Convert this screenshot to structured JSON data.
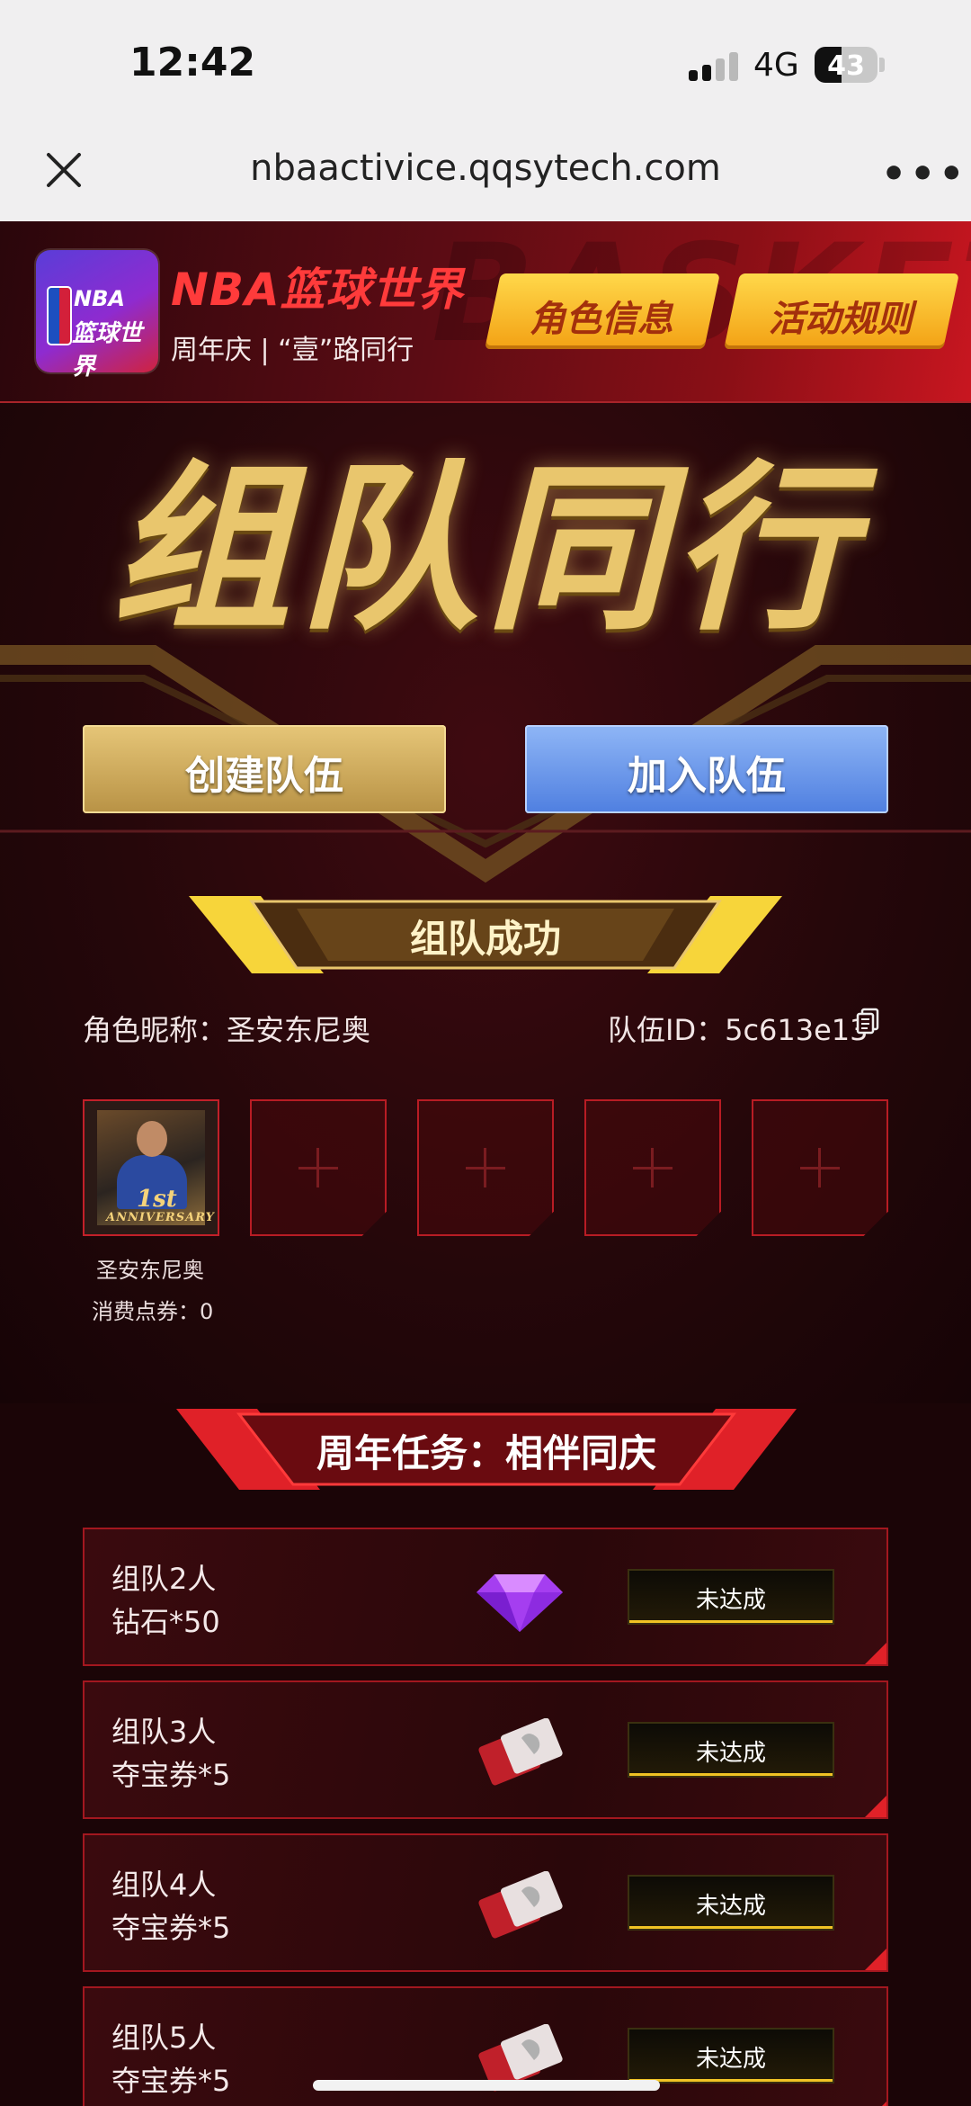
{
  "status_bar": {
    "time": "12:42",
    "network": "4G",
    "battery": "43",
    "battery_level_percent": 43
  },
  "browser": {
    "url": "nbaactivice.qqsytech.com",
    "close_icon": "close-icon",
    "more_icon": "more-icon"
  },
  "header": {
    "logo_line1": "NBA",
    "logo_line2": "篮球世界",
    "brand_title": "NBA篮球世界",
    "brand_subtitle": "周年庆 | “壹”路同行",
    "watermark": "BASKETBA",
    "role_info_label": "角色信息",
    "rules_label": "活动规则"
  },
  "hero": {
    "title": "组队同行",
    "create_team_label": "创建队伍",
    "join_team_label": "加入队伍"
  },
  "team": {
    "section_title": "组队成功",
    "nickname_text": "角色昵称：圣安东尼奥",
    "team_id_text": "队伍ID：5c613e13",
    "member": {
      "name": "圣安东尼奥",
      "points": "消费点券：0",
      "badge": "1st",
      "badge_sub": "ANNIVERSARY"
    },
    "empty_slots": 4
  },
  "tasks": {
    "section_title": "周年任务：相伴同庆",
    "items": [
      {
        "title": "组队2人",
        "reward": "钻石*50",
        "icon": "diamond-icon",
        "status": "未达成"
      },
      {
        "title": "组队3人",
        "reward": "夺宝券*5",
        "icon": "ticket-icon",
        "status": "未达成"
      },
      {
        "title": "组队4人",
        "reward": "夺宝券*5",
        "icon": "ticket-icon",
        "status": "未达成"
      },
      {
        "title": "组队5人",
        "reward": "夺宝券*5",
        "icon": "ticket-icon",
        "status": "未达成"
      }
    ]
  },
  "colors": {
    "accent_gold": "#e9c66d",
    "accent_red": "#c81620",
    "join_blue": "#4f7fe0"
  }
}
